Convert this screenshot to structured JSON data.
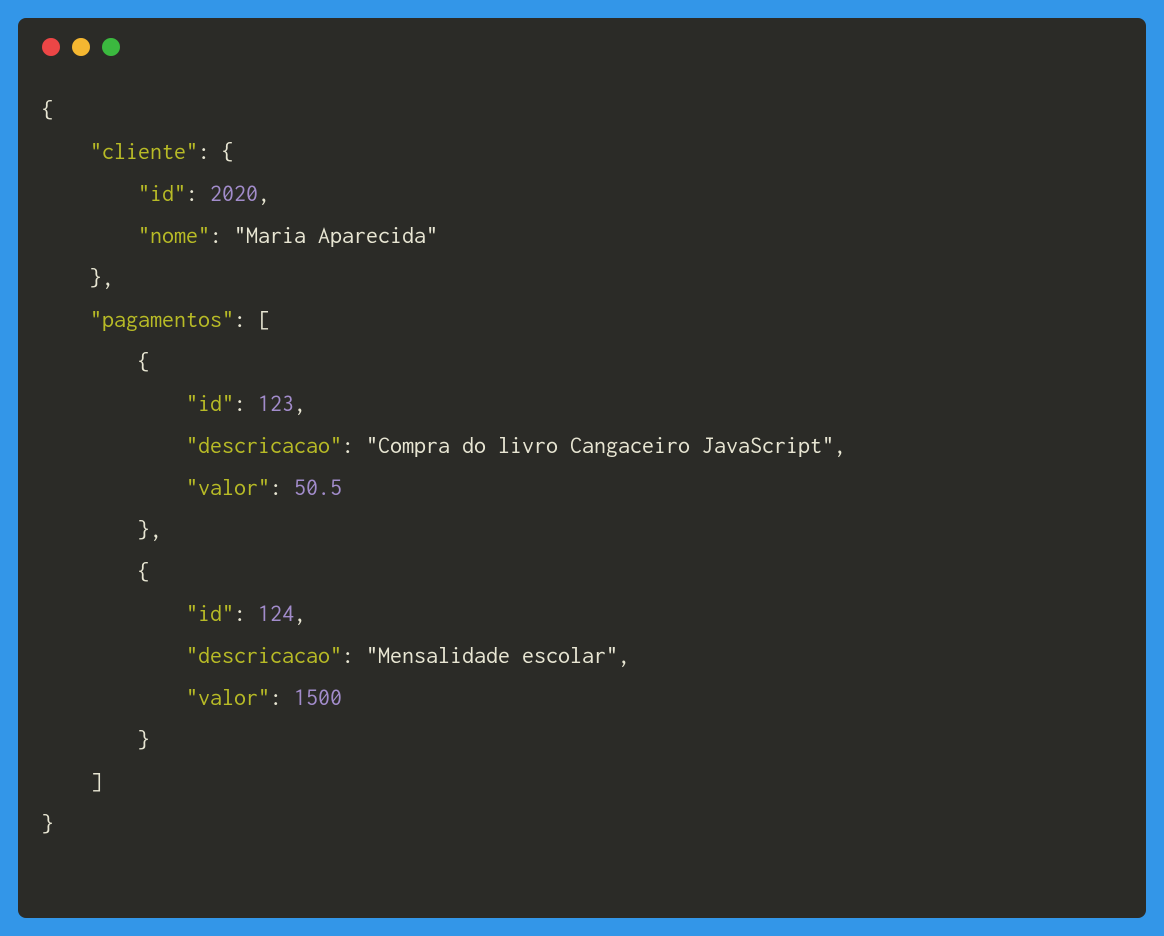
{
  "colors": {
    "frame": "#3396e8",
    "background": "#2b2b27",
    "key": "#b8bb26",
    "number": "#a28ccb",
    "text": "#e8e6d3",
    "dot_red": "#ec4646",
    "dot_yellow": "#f5b731",
    "dot_green": "#3bb93f"
  },
  "code": {
    "keys": {
      "cliente": "\"cliente\"",
      "id": "\"id\"",
      "nome": "\"nome\"",
      "pagamentos": "\"pagamentos\"",
      "descricacao": "\"descricacao\"",
      "valor": "\"valor\""
    },
    "values": {
      "cliente_id": "2020",
      "cliente_nome": "\"Maria Aparecida\"",
      "p1_id": "123",
      "p1_desc": "\"Compra do livro Cangaceiro JavaScript\"",
      "p1_valor": "50.5",
      "p2_id": "124",
      "p2_desc": "\"Mensalidade escolar\"",
      "p2_valor": "1500"
    },
    "punct": {
      "open_brace": "{",
      "close_brace": "}",
      "open_bracket": "[",
      "close_bracket": "]",
      "colon_space": ": ",
      "comma": ",",
      "close_brace_comma": "},"
    },
    "indent": {
      "i0": "",
      "i1": "    ",
      "i2": "        ",
      "i3": "            "
    }
  }
}
